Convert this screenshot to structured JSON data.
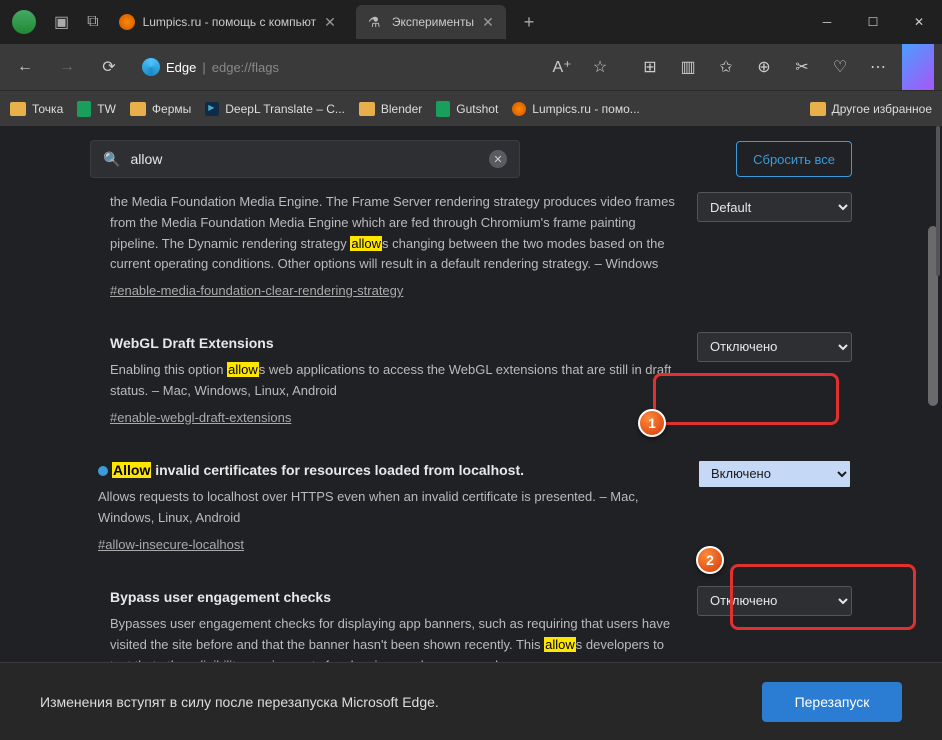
{
  "titlebar": {
    "tab1": "Lumpics.ru - помощь с компьют",
    "tab2": "Эксперименты"
  },
  "toolbar": {
    "edge_label": "Edge",
    "url": "edge://flags"
  },
  "bookmarks": {
    "tochka": "Точка",
    "tw": "TW",
    "fermy": "Фермы",
    "deepl": "DeepL Translate – C...",
    "blender": "Blender",
    "gutshot": "Gutshot",
    "lumpics": "Lumpics.ru - помо...",
    "other": "Другое избранное"
  },
  "search": {
    "value": "allow",
    "reset": "Сбросить все"
  },
  "flags": {
    "f1": {
      "desc_a": "the Media Foundation Media Engine. The Frame Server rendering strategy produces video frames from the Media Foundation Media Engine which are fed through Chromium's frame painting pipeline. The Dynamic rendering strategy ",
      "mark": "allow",
      "desc_b": "s changing between the two modes based on the current operating conditions. Other options will result in a default rendering strategy. – Windows",
      "hash": "#enable-media-foundation-clear-rendering-strategy",
      "select": "Default"
    },
    "f2": {
      "title": "WebGL Draft Extensions",
      "desc_a": "Enabling this option ",
      "mark": "allow",
      "desc_b": "s web applications to access the WebGL extensions that are still in draft status. – Mac, Windows, Linux, Android",
      "hash": "#enable-webgl-draft-extensions",
      "select": "Отключено"
    },
    "f3": {
      "title_mark": "Allow",
      "title_rest": " invalid certificates for resources loaded from localhost.",
      "desc": "Allows requests to localhost over HTTPS even when an invalid certificate is presented. – Mac, Windows, Linux, Android",
      "hash": "#allow-insecure-localhost",
      "select": "Включено"
    },
    "f4": {
      "title": "Bypass user engagement checks",
      "desc_a": "Bypasses user engagement checks for displaying app banners, such as requiring that users have visited the site before and that the banner hasn't been shown recently. This ",
      "mark": "allow",
      "desc_b": "s developers to test that other eligibility requirements for showing app banners, such as",
      "select": "Отключено"
    }
  },
  "footer": {
    "text": "Изменения вступят в силу после перезапуска Microsoft Edge.",
    "restart": "Перезапуск"
  },
  "badges": {
    "b1": "1",
    "b2": "2"
  }
}
